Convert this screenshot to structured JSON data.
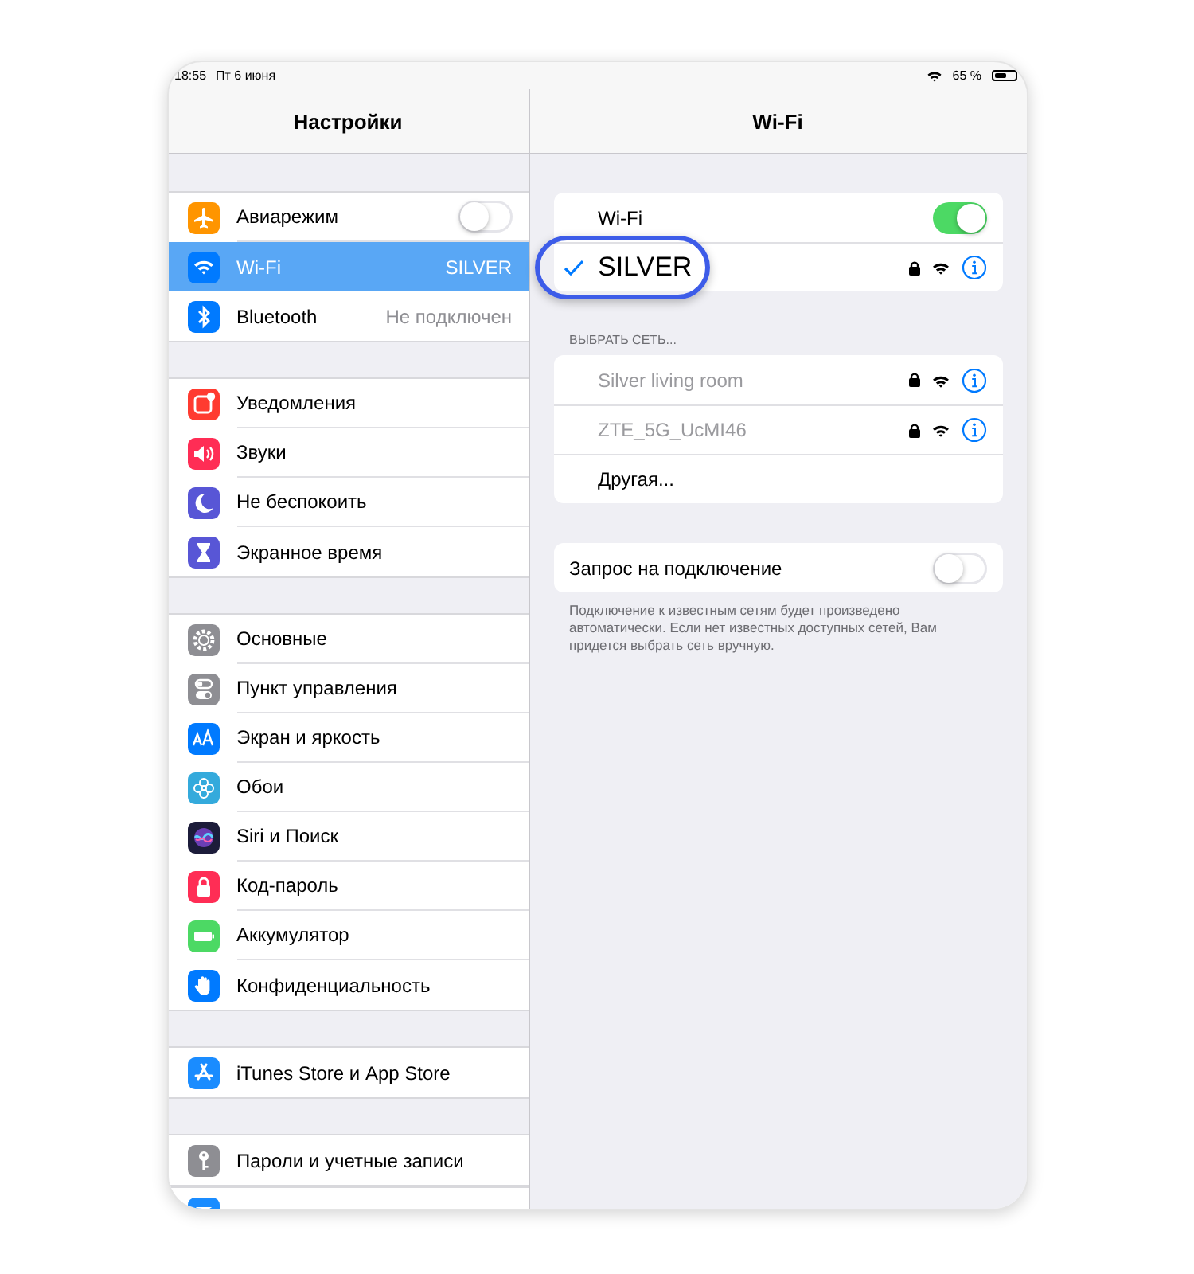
{
  "status_bar": {
    "time": "18:55",
    "date": "Пт 6 июня",
    "battery": "65 %"
  },
  "sidebar": {
    "title": "Настройки",
    "groups": [
      {
        "items": [
          {
            "label": "Авиарежим",
            "kind": "toggle",
            "on": false,
            "selected": false,
            "color": "#ff9500"
          },
          {
            "label": "Wi-Fi",
            "kind": "value",
            "value": "SILVER",
            "selected": true,
            "color": "#007aff"
          },
          {
            "label": "Bluetooth",
            "kind": "value",
            "value": "Не подключен",
            "selected": false,
            "color": "#007aff"
          }
        ]
      },
      {
        "items": [
          {
            "label": "Уведомления",
            "kind": "plain",
            "selected": false,
            "color": "#ff3b30"
          },
          {
            "label": "Звуки",
            "kind": "plain",
            "selected": false,
            "color": "#ff2d55"
          },
          {
            "label": "Не беспокоить",
            "kind": "plain",
            "selected": false,
            "color": "#5856d6"
          },
          {
            "label": "Экранное время",
            "kind": "plain",
            "selected": false,
            "color": "#5856d6"
          }
        ]
      },
      {
        "items": [
          {
            "label": "Основные",
            "kind": "plain",
            "selected": false,
            "color": "#8e8e93"
          },
          {
            "label": "Пункт управления",
            "kind": "plain",
            "selected": false,
            "color": "#8e8e93"
          },
          {
            "label": "Экран и яркость",
            "kind": "plain",
            "selected": false,
            "color": "#007aff"
          },
          {
            "label": "Обои",
            "kind": "plain",
            "selected": false,
            "color": "#34aadc"
          },
          {
            "label": "Siri и Поиск",
            "kind": "plain",
            "selected": false,
            "color": "#1c1c3a"
          },
          {
            "label": "Код-пароль",
            "kind": "plain",
            "selected": false,
            "color": "#ff2d55"
          },
          {
            "label": "Аккумулятор",
            "kind": "plain",
            "selected": false,
            "color": "#4cd964"
          },
          {
            "label": "Конфиденциальность",
            "kind": "plain",
            "selected": false,
            "color": "#007aff"
          }
        ]
      },
      {
        "items": [
          {
            "label": "iTunes Store и App Store",
            "kind": "plain",
            "selected": false,
            "color": "#1a8cff"
          }
        ]
      },
      {
        "items": [
          {
            "label": "Пароли и учетные записи",
            "kind": "plain",
            "selected": false,
            "color": "#8e8e93"
          }
        ]
      }
    ]
  },
  "detail": {
    "title": "Wi-Fi",
    "wifi_toggle": {
      "label": "Wi-Fi",
      "on": true
    },
    "connected": {
      "name": "SILVER",
      "checked": true,
      "highlighted": true,
      "locked": true
    },
    "networks_header": "ВЫБРАТЬ СЕТЬ...",
    "networks": [
      {
        "name": "Silver living room",
        "kind": "network",
        "locked": true
      },
      {
        "name": "ZTE_5G_UcMI46",
        "kind": "network",
        "locked": true
      },
      {
        "name": "Другая...",
        "kind": "other"
      }
    ],
    "ask_to_join": {
      "label": "Запрос на подключение",
      "on": false
    },
    "footnote": "Подключение к известным сетям будет произведено автоматически. Если нет известных доступных сетей, Вам придется выбрать сеть вручную."
  }
}
